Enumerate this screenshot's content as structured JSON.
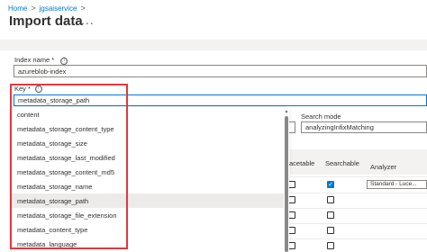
{
  "breadcrumb": {
    "home": "Home",
    "sep": ">",
    "service": "jgsaiservice",
    "sep2": ">"
  },
  "page": {
    "title": "Import data",
    "more": "..."
  },
  "index_name": {
    "label": "Index name",
    "required": "*",
    "info_icon": "ⓘ",
    "value": "azureblob-index"
  },
  "key": {
    "label": "Key",
    "required": "*",
    "info_icon": "ⓘ",
    "value": "metadata_storage_path"
  },
  "dropdown": {
    "items": [
      "content",
      "metadata_storage_content_type",
      "metadata_storage_size",
      "metadata_storage_last_modified",
      "metadata_storage_content_md5",
      "metadata_storage_name",
      "metadata_storage_path",
      "metadata_storage_file_extension",
      "metadata_content_type",
      "metadata_language"
    ],
    "selected_index": 6
  },
  "search_mode": {
    "label": "Search mode",
    "value": "analyzingInfixMatching"
  },
  "table": {
    "col_facetable": "acetable",
    "col_searchable": "Searchable",
    "col_analyzer": "Analyzer",
    "analyzer_value": "Standard - Luce...",
    "searchable_checked_row": 0
  },
  "icons": {
    "chevron": "⌄",
    "check": "✓",
    "scroll_up": "▲"
  },
  "colors": {
    "accent": "#0078d4",
    "highlight": "#e0393e",
    "selected_row": "#edebe9"
  }
}
